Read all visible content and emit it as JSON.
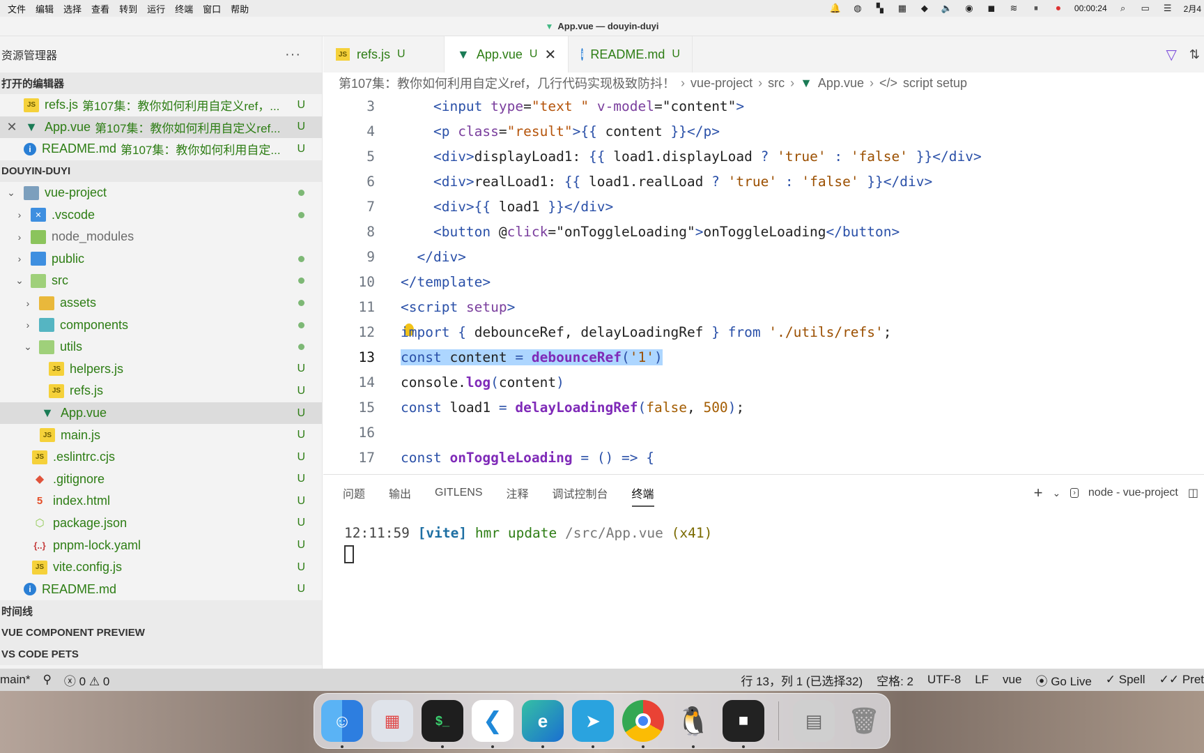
{
  "menubar": {
    "menus": [
      "文件",
      "编辑",
      "选择",
      "查看",
      "转到",
      "运行",
      "终端",
      "窗口",
      "帮助"
    ],
    "timer": "00:00:24",
    "date": "2月4"
  },
  "window": {
    "title": "App.vue — douyin-duyi"
  },
  "sidebar": {
    "header": "资源管理器",
    "more": "···",
    "open_editors_title": "打开的编辑器",
    "open_editors": [
      {
        "name": "refs.js",
        "desc": "第107集：教你如何利用自定义ref，...",
        "badge": "U"
      },
      {
        "name": "App.vue",
        "desc": "第107集：教你如何利用自定义ref...",
        "badge": "U"
      },
      {
        "name": "README.md",
        "desc": "第107集：教你如何利用自定...",
        "badge": "U"
      }
    ],
    "project_title": "DOUYIN-DUYI",
    "tree": {
      "vue_project": "vue-project",
      "vscode": ".vscode",
      "node_modules": "node_modules",
      "public": "public",
      "src": "src",
      "assets": "assets",
      "components": "components",
      "utils": "utils",
      "helpers": "helpers.js",
      "refs": "refs.js",
      "app": "App.vue",
      "main": "main.js",
      "eslintrc": ".eslintrc.cjs",
      "gitignore": ".gitignore",
      "index": "index.html",
      "package": "package.json",
      "pnpm": "pnpm-lock.yaml",
      "vite": "vite.config.js",
      "readme": "README.md",
      "badge": "U"
    },
    "timeline": "时间线",
    "vue_preview": "VUE COMPONENT PREVIEW",
    "pets": "VS CODE PETS"
  },
  "tabs": [
    {
      "name": "refs.js",
      "badge": "U"
    },
    {
      "name": "App.vue",
      "badge": "U"
    },
    {
      "name": "README.md",
      "badge": "U"
    }
  ],
  "breadcrumb": {
    "folder": "第107集：教你如何利用自定义ref，几行代码实现极致防抖！",
    "project": "vue-project",
    "src": "src",
    "file": "App.vue",
    "symbol": "script setup"
  },
  "code": {
    "line_numbers": [
      "3",
      "4",
      "5",
      "6",
      "7",
      "8",
      "9",
      "10",
      "11",
      "12",
      "13",
      "14",
      "15",
      "16",
      "17"
    ]
  },
  "panel": {
    "tabs": [
      "问题",
      "输出",
      "GITLENS",
      "注释",
      "调试控制台",
      "终端"
    ],
    "terminal_name": "node - vue-project",
    "terminal": {
      "time": "12:11:59",
      "tag": "[vite]",
      "msg": "hmr update",
      "path": "/src/App.vue",
      "count": "(x41)"
    }
  },
  "statusbar": {
    "branch": "main*",
    "errors": "0",
    "warnings": "0",
    "position": "行 13，列 1 (已选择32)",
    "spaces": "空格: 2",
    "encoding": "UTF-8",
    "eol": "LF",
    "lang": "vue",
    "golive": "Go Live",
    "spell": "Spell",
    "prettier": "Pret"
  },
  "colors": {
    "accent_green": "#2d7d14",
    "selection": "#add6ff",
    "vue": "#42b883"
  }
}
